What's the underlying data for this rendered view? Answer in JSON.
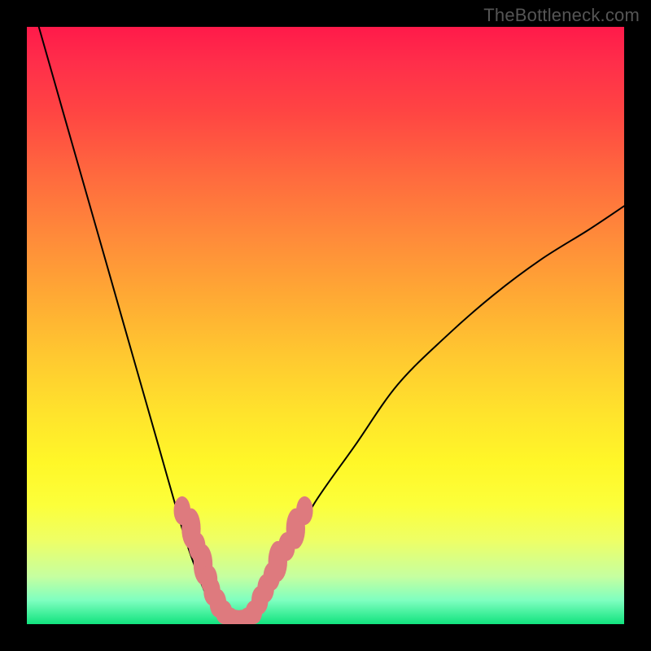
{
  "watermark": "TheBottleneck.com",
  "colors": {
    "curve_stroke": "#000000",
    "marker_fill": "#de7a7e",
    "marker_stroke": "#de7a7e"
  },
  "chart_data": {
    "type": "line",
    "title": "",
    "xlabel": "",
    "ylabel": "",
    "xlim": [
      0,
      100
    ],
    "ylim": [
      0,
      100
    ],
    "series": [
      {
        "name": "bottleneck-curve",
        "x": [
          2,
          6,
          10,
          14,
          18,
          22,
          26,
          28,
          30,
          32,
          33,
          34,
          35,
          36,
          38,
          40,
          42,
          44,
          48,
          55,
          62,
          70,
          78,
          86,
          94,
          100
        ],
        "y": [
          100,
          86,
          72,
          58,
          44,
          30,
          16,
          10,
          5,
          2,
          1,
          0.5,
          0.5,
          0.6,
          1.5,
          4,
          8,
          12,
          20,
          30,
          40,
          48,
          55,
          61,
          66,
          70
        ]
      }
    ],
    "markers": {
      "name": "highlighted-points",
      "x": [
        26,
        27.5,
        28.5,
        29.5,
        30.5,
        31,
        32,
        33,
        34,
        35,
        36,
        37,
        38,
        39,
        40,
        41,
        42,
        43.5,
        45,
        46.5
      ],
      "y": [
        19,
        16,
        13,
        10,
        7.5,
        5.5,
        3.5,
        2,
        1.2,
        1,
        1,
        1.2,
        2,
        4,
        6,
        8,
        10.5,
        13,
        16,
        19
      ],
      "rx": [
        1.4,
        1.6,
        1.4,
        1.6,
        1.4,
        1.4,
        1.4,
        1.4,
        1.4,
        1.4,
        1.4,
        1.4,
        1.4,
        1.4,
        1.4,
        1.4,
        1.6,
        1.4,
        1.6,
        1.4
      ],
      "ry": [
        2.4,
        3.4,
        2.4,
        3.4,
        2.4,
        2.4,
        2.4,
        2.0,
        1.6,
        1.4,
        1.4,
        1.6,
        2.0,
        2.4,
        2.4,
        2.4,
        3.4,
        2.4,
        3.4,
        2.4
      ]
    }
  }
}
